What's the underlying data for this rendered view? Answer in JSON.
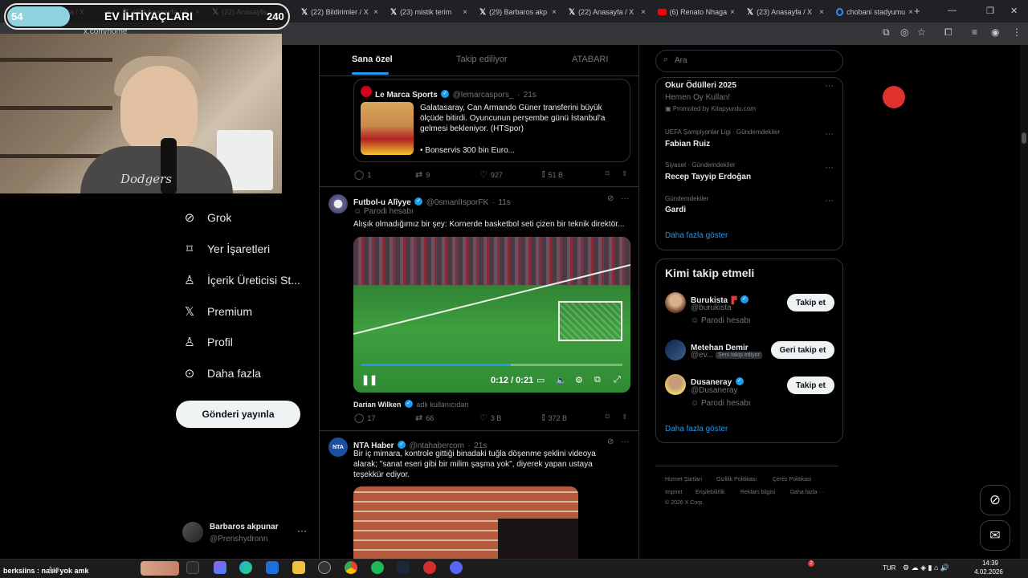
{
  "overlay": {
    "goal_current": "54",
    "goal_title": "EV İHTİYAÇLARI",
    "goal_max": "240",
    "goal_fraction": 0.225,
    "webcam_brand_text": "Dodgers"
  },
  "browser": {
    "tabs": [
      {
        "title": "Anasayfa / X",
        "icon": "x-icon"
      },
      {
        "title": "(23) Anasayfa / X",
        "icon": "x-icon"
      },
      {
        "title": "(22) Anasayfa",
        "icon": "x-icon"
      },
      {
        "title": "(22) Bildirimler / X",
        "icon": "x-icon"
      },
      {
        "title": "(23) mistik terim",
        "icon": "x-icon"
      },
      {
        "title": "(29) Barbaros akp",
        "icon": "x-icon"
      },
      {
        "title": "(22) Anasayfa / X",
        "icon": "x-icon"
      },
      {
        "title": "(6) Renato Nhaga",
        "icon": "youtube-icon"
      },
      {
        "title": "(23) Anasayfa / X",
        "icon": "x-icon"
      },
      {
        "title": "chobani stadyumu",
        "icon": "google-icon"
      }
    ],
    "url": "x.com/home",
    "new_tab": "+",
    "tab_close": "×"
  },
  "nav": {
    "items": [
      {
        "label": "Grok",
        "icon": "grok-icon"
      },
      {
        "label": "Yer İşaretleri",
        "icon": "bookmark-icon"
      },
      {
        "label": "İçerik Üreticisi St...",
        "icon": "creator-icon"
      },
      {
        "label": "Premium",
        "icon": "x-logo-icon"
      },
      {
        "label": "Profil",
        "icon": "profile-icon"
      },
      {
        "label": "Daha fazla",
        "icon": "more-icon"
      }
    ],
    "post_button": "Gönderi yayınla",
    "account": {
      "name": "Barbaros akpunar",
      "handle": "@Prenshydronn",
      "more": "···"
    }
  },
  "timeline": {
    "tabs": [
      "Sana özel",
      "Takip ediliyor",
      "ATABARI"
    ],
    "active_tab": 0,
    "quote": {
      "name": "Le Marca Sports",
      "handle": "@lemarcaspors_",
      "time": "21s",
      "text": "Galatasaray, Can Armando Güner transferini büyük ölçüde bitirdi. Oyuncunun perşembe günü İstanbul'a gelmesi bekleniyor. (HTSpor)",
      "text2": "• Bonservis 300 bin Euro..."
    },
    "post1_actions": {
      "replies": "1",
      "reposts": "9",
      "likes": "927",
      "views": "51 B"
    },
    "post2": {
      "name": "Futbol-u Alîyye",
      "handle": "@0smanlIsporFK",
      "time": "11s",
      "label": "Parodi hesabı",
      "text": "Alışık olmadığımız bir şey: Kornerde basketbol seti çizen bir teknik direktör...",
      "video_time": "0:12 / 0:21",
      "video_progress": 0.571,
      "credit_name": "Darian Wilken",
      "credit_label": "adlı kullanıcıdan",
      "actions": {
        "replies": "17",
        "reposts": "66",
        "likes": "3 B",
        "views": "372 B"
      }
    },
    "post3": {
      "name": "NTA Haber",
      "handle": "@ntahabercom",
      "time": "21s",
      "text": "Bir iç mimara, kontrole gittiği binadaki tuğla döşenme şeklini videoya alarak; \"sanat eseri gibi bir milim şaşma yok\", diyerek yapan ustaya teşekkür ediyor."
    }
  },
  "right": {
    "search_placeholder": "Ara",
    "trends": [
      {
        "context": "",
        "title": "Okur Ödülleri 2025",
        "subtitle": "Hemen Oy Kullan!",
        "promoted": "Promoted by Kitapyurdu.com"
      },
      {
        "context": "UEFA Şampiyonlar Ligi · Gündemdekiler",
        "title": "Fabian Ruiz"
      },
      {
        "context": "Siyaset · Gündemdekiler",
        "title": "Recep Tayyip Erdoğan"
      },
      {
        "context": "Gündemdekiler",
        "title": "Gardi"
      }
    ],
    "trends_more": "Daha fazla göster",
    "who_to_follow_title": "Kimi takip etmeli",
    "suggestions": [
      {
        "name": "Burukista",
        "handle": "@burukista",
        "label": "Parodi hesabı",
        "button": "Takip et"
      },
      {
        "name": "Metehan Demir",
        "handle": "@ev...",
        "chip": "Seni takip ediyor",
        "button": "Geri takip et"
      },
      {
        "name": "Dusaneray",
        "handle": "@Dusaneray",
        "label": "Parodi hesabı",
        "button": "Takip et"
      }
    ],
    "follow_more": "Daha fazla göster",
    "footer": [
      "Hizmet Şartları",
      "Gizlilik Politikası",
      "Çerez Politikası",
      "Imprint",
      "Erişilebilirlik",
      "Reklam bilgisi",
      "Daha fazla ···",
      "© 2026 X Corp."
    ]
  },
  "taskbar": {
    "chat_text": "berksiins : nasıl yok amk",
    "search_hint": "Ara",
    "lang": "TUR",
    "time": "14:39",
    "date": "4.02.2026",
    "badge": "2"
  }
}
